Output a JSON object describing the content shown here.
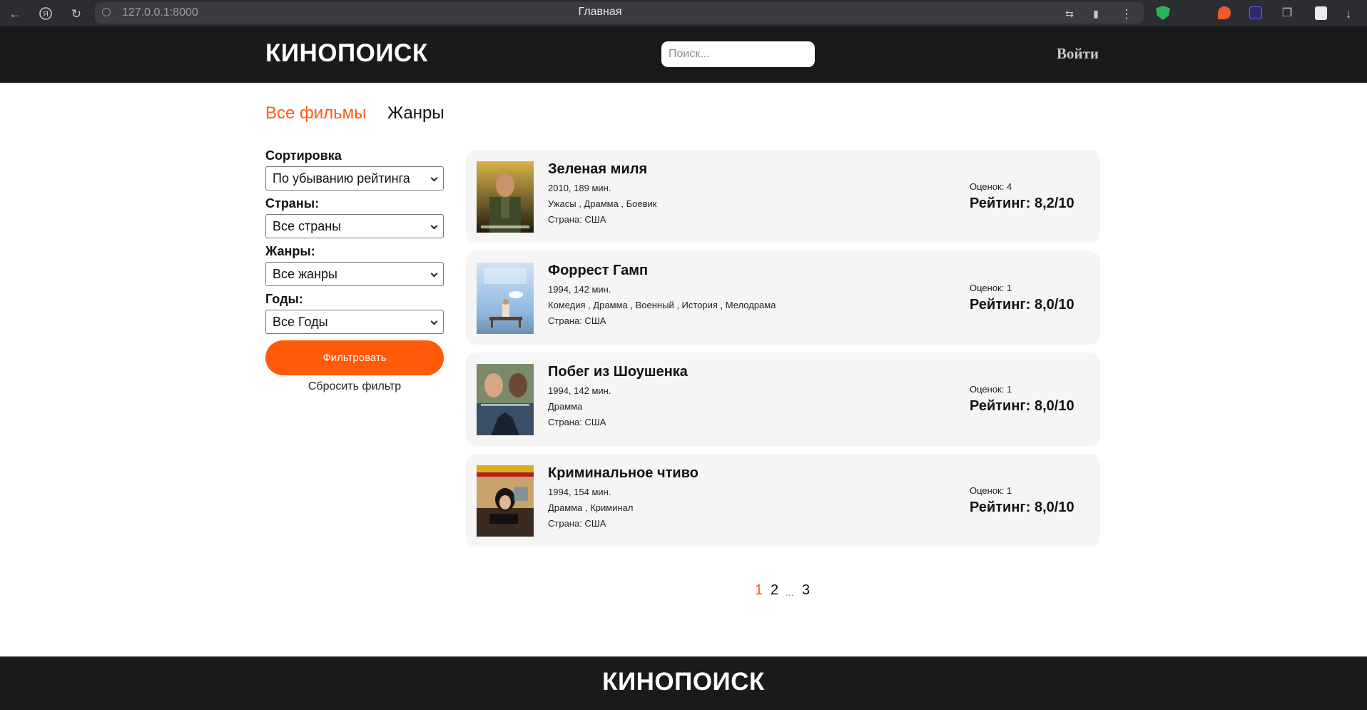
{
  "browser": {
    "url": "127.0.0.1:8000",
    "tab_title": "Главная"
  },
  "header": {
    "logo": "КИНОПОИСК",
    "search_placeholder": "Поиск...",
    "login_label": "Войти"
  },
  "nav": {
    "all_films": "Все фильмы",
    "genres": "Жанры"
  },
  "filters": {
    "sort_label": "Сортировка",
    "sort_value": "По убыванию рейтинга",
    "countries_label": "Страны:",
    "countries_value": "Все страны",
    "genres_label": "Жанры:",
    "genres_value": "Все жанры",
    "years_label": "Годы:",
    "years_value": "Все Годы",
    "filter_button": "Фильтровать",
    "reset_link": "Сбросить фильтр"
  },
  "movies": [
    {
      "title": "Зеленая миля",
      "info": "2010, 189 мин.",
      "genres": "Ужасы , Драмма , Боевик",
      "country": "Страна: США",
      "votes": "Оценок: 4",
      "rating": "Рейтинг: 8,2/10"
    },
    {
      "title": "Форрест Гамп",
      "info": "1994, 142 мин.",
      "genres": "Комедия , Драмма , Военный , История , Мелодрама",
      "country": "Страна: США",
      "votes": "Оценок: 1",
      "rating": "Рейтинг: 8,0/10"
    },
    {
      "title": "Побег из Шоушенка",
      "info": "1994, 142 мин.",
      "genres": "Драмма",
      "country": "Страна: США",
      "votes": "Оценок: 1",
      "rating": "Рейтинг: 8,0/10"
    },
    {
      "title": "Криминальное чтиво",
      "info": "1994, 154 мин.",
      "genres": "Драмма , Криминал",
      "country": "Страна: США",
      "votes": "Оценок: 1",
      "rating": "Рейтинг: 8,0/10"
    }
  ],
  "pagination": {
    "current": "1",
    "next": "2",
    "dots": "...",
    "last": "3"
  },
  "footer": {
    "logo": "КИНОПОИСК"
  },
  "colors": {
    "accent": "#ff5a16",
    "header_bg": "#1a1a1a",
    "card_bg": "#f5f5f5"
  }
}
